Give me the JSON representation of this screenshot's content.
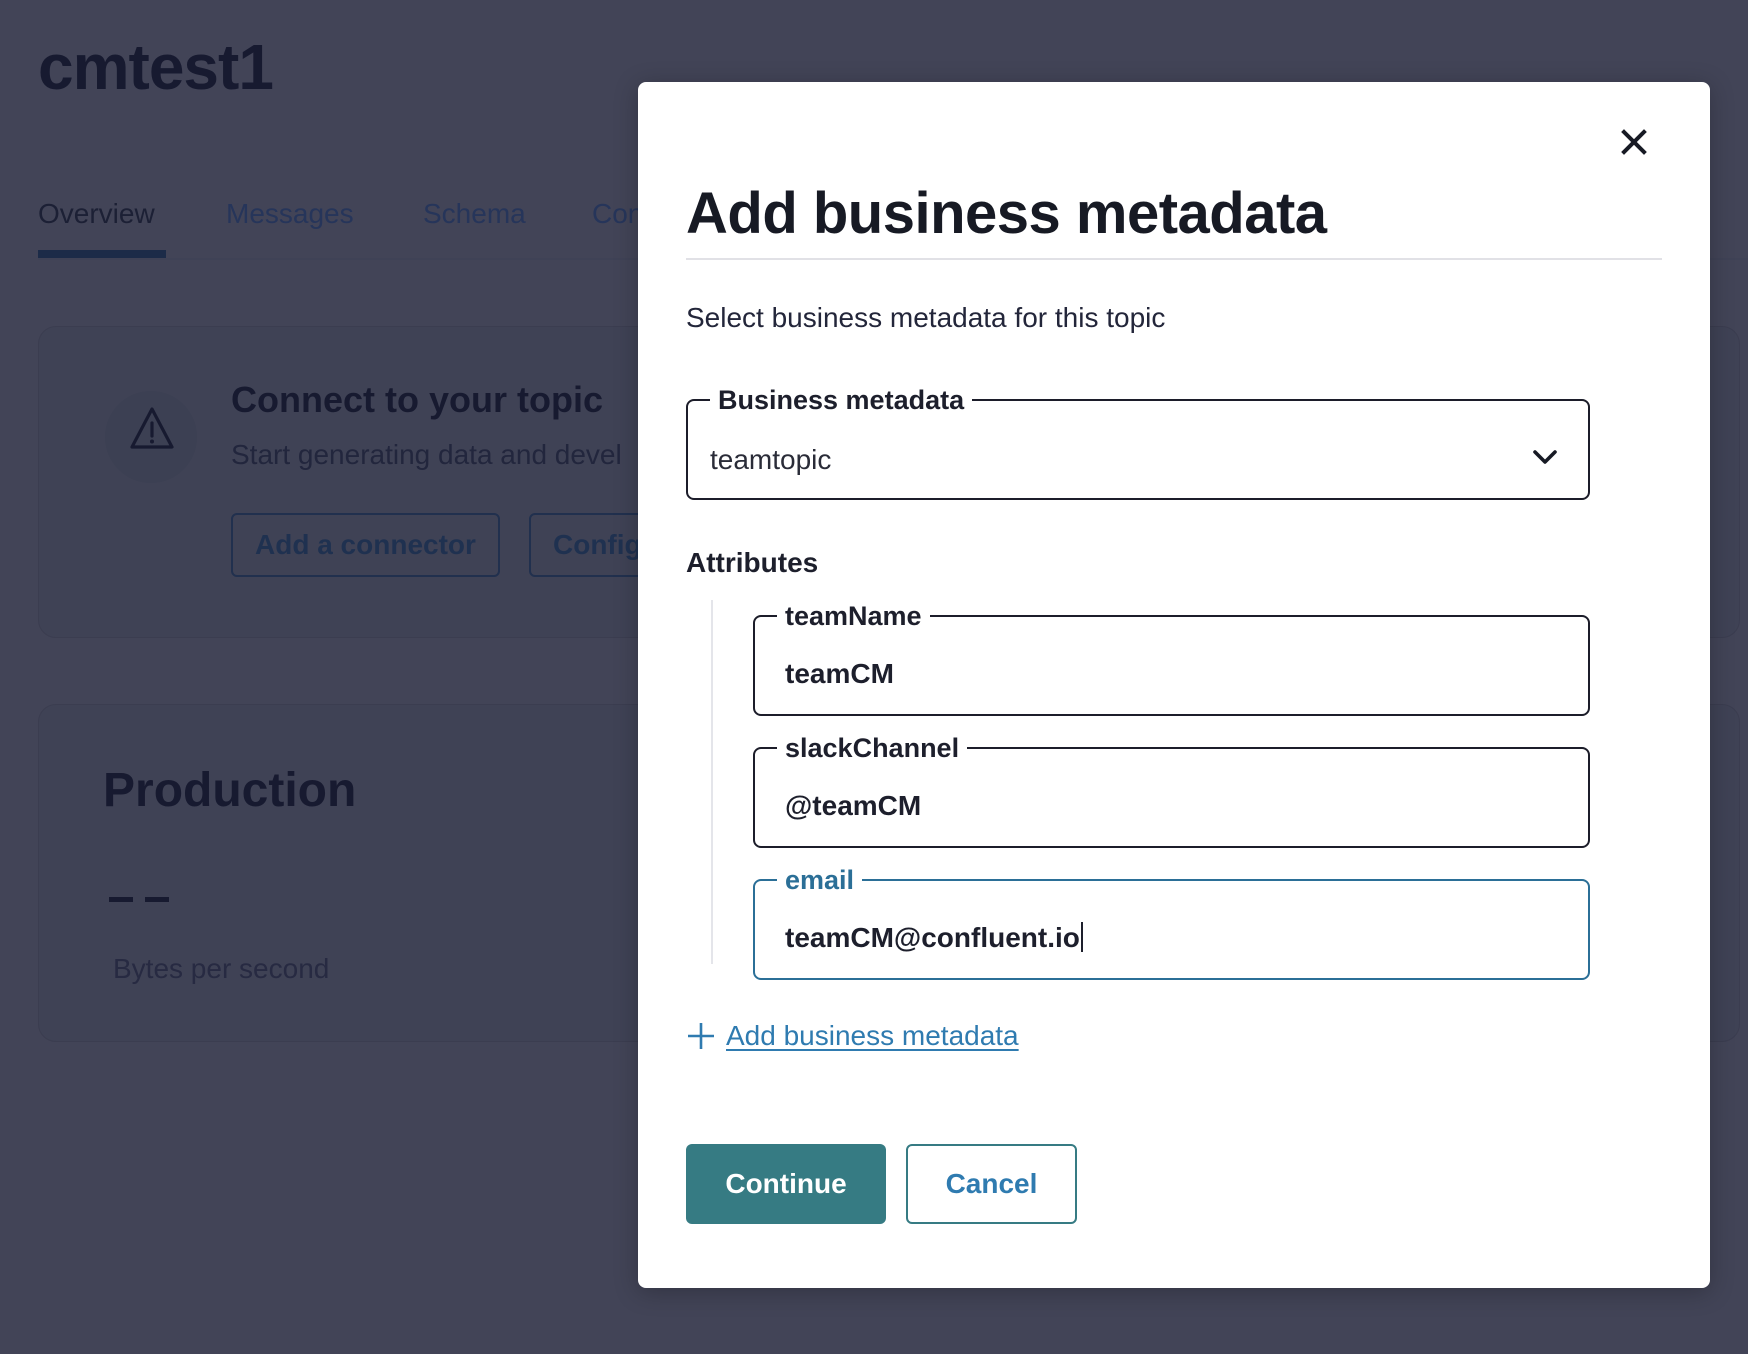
{
  "page": {
    "topic_name": "cmtest1",
    "tabs": [
      {
        "label": "Overview",
        "active": true
      },
      {
        "label": "Messages",
        "active": false
      },
      {
        "label": "Schema",
        "active": false
      },
      {
        "label": "Con",
        "active": false
      }
    ],
    "connect_card": {
      "icon": "warning-triangle-icon",
      "title": "Connect to your topic",
      "description": "Start generating data and devel",
      "buttons": [
        "Add a connector",
        "Config"
      ]
    },
    "production_card": {
      "title": "Production",
      "value": "— —",
      "unit_label": "Bytes per second"
    }
  },
  "modal": {
    "title": "Add business metadata",
    "close_icon": "close-icon",
    "subtitle": "Select business metadata for this topic",
    "business_metadata_select": {
      "label": "Business metadata",
      "value": "teamtopic",
      "icon": "chevron-down-icon"
    },
    "attributes_label": "Attributes",
    "attributes": [
      {
        "label": "teamName",
        "value": "teamCM",
        "focused": false
      },
      {
        "label": "slackChannel",
        "value": "@teamCM",
        "focused": false
      },
      {
        "label": "email",
        "value": "teamCM@confluent.io",
        "focused": true
      }
    ],
    "add_link": {
      "icon": "plus-icon",
      "label": "Add business metadata"
    },
    "continue_label": "Continue",
    "cancel_label": "Cancel"
  },
  "colors": {
    "overlay": "#424457",
    "primary": "#367b83",
    "link": "#2f7bb0",
    "focus": "#2b6f97"
  }
}
